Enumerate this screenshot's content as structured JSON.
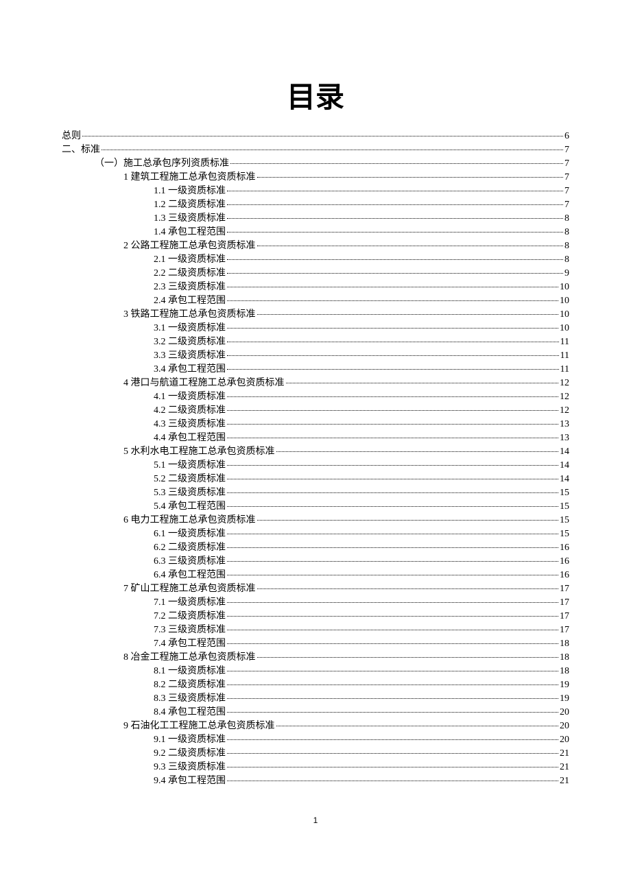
{
  "title": "目录",
  "pageNumber": "1",
  "toc": [
    {
      "level": 0,
      "label": "总则",
      "page": "6"
    },
    {
      "level": 0,
      "label": "二、标准",
      "page": "7"
    },
    {
      "level": 1,
      "label": "（一）施工总承包序列资质标准",
      "page": "7"
    },
    {
      "level": 2,
      "label": "1 建筑工程施工总承包资质标准",
      "page": "7"
    },
    {
      "level": 3,
      "label": "1.1 一级资质标准",
      "page": "7"
    },
    {
      "level": 3,
      "label": "1.2 二级资质标准",
      "page": "7"
    },
    {
      "level": 3,
      "label": "1.3 三级资质标准",
      "page": "8"
    },
    {
      "level": 3,
      "label": "1.4 承包工程范围",
      "page": "8"
    },
    {
      "level": 2,
      "label": "2 公路工程施工总承包资质标准",
      "page": "8"
    },
    {
      "level": 3,
      "label": "2.1 一级资质标准",
      "page": "8"
    },
    {
      "level": 3,
      "label": "2.2 二级资质标准",
      "page": "9"
    },
    {
      "level": 3,
      "label": "2.3 三级资质标准",
      "page": "10"
    },
    {
      "level": 3,
      "label": "2.4 承包工程范围",
      "page": "10"
    },
    {
      "level": 2,
      "label": "3 铁路工程施工总承包资质标准",
      "page": "10"
    },
    {
      "level": 3,
      "label": "3.1 一级资质标准",
      "page": "10"
    },
    {
      "level": 3,
      "label": "3.2 二级资质标准",
      "page": "11"
    },
    {
      "level": 3,
      "label": "3.3 三级资质标准",
      "page": "11"
    },
    {
      "level": 3,
      "label": "3.4 承包工程范围",
      "page": "11"
    },
    {
      "level": 2,
      "label": "4 港口与航道工程施工总承包资质标准",
      "page": "12"
    },
    {
      "level": 3,
      "label": "4.1 一级资质标准",
      "page": "12"
    },
    {
      "level": 3,
      "label": "4.2 二级资质标准",
      "page": "12"
    },
    {
      "level": 3,
      "label": "4.3 三级资质标准",
      "page": "13"
    },
    {
      "level": 3,
      "label": "4.4 承包工程范围",
      "page": "13"
    },
    {
      "level": 2,
      "label": "5 水利水电工程施工总承包资质标准",
      "page": "14"
    },
    {
      "level": 3,
      "label": "5.1 一级资质标准",
      "page": "14"
    },
    {
      "level": 3,
      "label": "5.2 二级资质标准",
      "page": "14"
    },
    {
      "level": 3,
      "label": "5.3 三级资质标准",
      "page": "15"
    },
    {
      "level": 3,
      "label": "5.4 承包工程范围",
      "page": "15"
    },
    {
      "level": 2,
      "label": "6 电力工程施工总承包资质标准",
      "page": "15"
    },
    {
      "level": 3,
      "label": "6.1 一级资质标准",
      "page": "15"
    },
    {
      "level": 3,
      "label": "6.2 二级资质标准",
      "page": "16"
    },
    {
      "level": 3,
      "label": "6.3 三级资质标准",
      "page": "16"
    },
    {
      "level": 3,
      "label": "6.4 承包工程范围",
      "page": "16"
    },
    {
      "level": 2,
      "label": "7 矿山工程施工总承包资质标准",
      "page": "17"
    },
    {
      "level": 3,
      "label": "7.1 一级资质标准",
      "page": "17"
    },
    {
      "level": 3,
      "label": "7.2 二级资质标准",
      "page": "17"
    },
    {
      "level": 3,
      "label": "7.3 三级资质标准",
      "page": "17"
    },
    {
      "level": 3,
      "label": "7.4 承包工程范围",
      "page": "18"
    },
    {
      "level": 2,
      "label": "8 冶金工程施工总承包资质标准",
      "page": "18"
    },
    {
      "level": 3,
      "label": "8.1 一级资质标准",
      "page": "18"
    },
    {
      "level": 3,
      "label": "8.2 二级资质标准",
      "page": "19"
    },
    {
      "level": 3,
      "label": "8.3 三级资质标准",
      "page": "19"
    },
    {
      "level": 3,
      "label": "8.4 承包工程范围",
      "page": "20"
    },
    {
      "level": 2,
      "label": "9 石油化工工程施工总承包资质标准",
      "page": "20"
    },
    {
      "level": 3,
      "label": "9.1 一级资质标准",
      "page": "20"
    },
    {
      "level": 3,
      "label": "9.2 二级资质标准",
      "page": "21"
    },
    {
      "level": 3,
      "label": "9.3 三级资质标准",
      "page": "21"
    },
    {
      "level": 3,
      "label": "9.4 承包工程范围",
      "page": "21"
    }
  ]
}
